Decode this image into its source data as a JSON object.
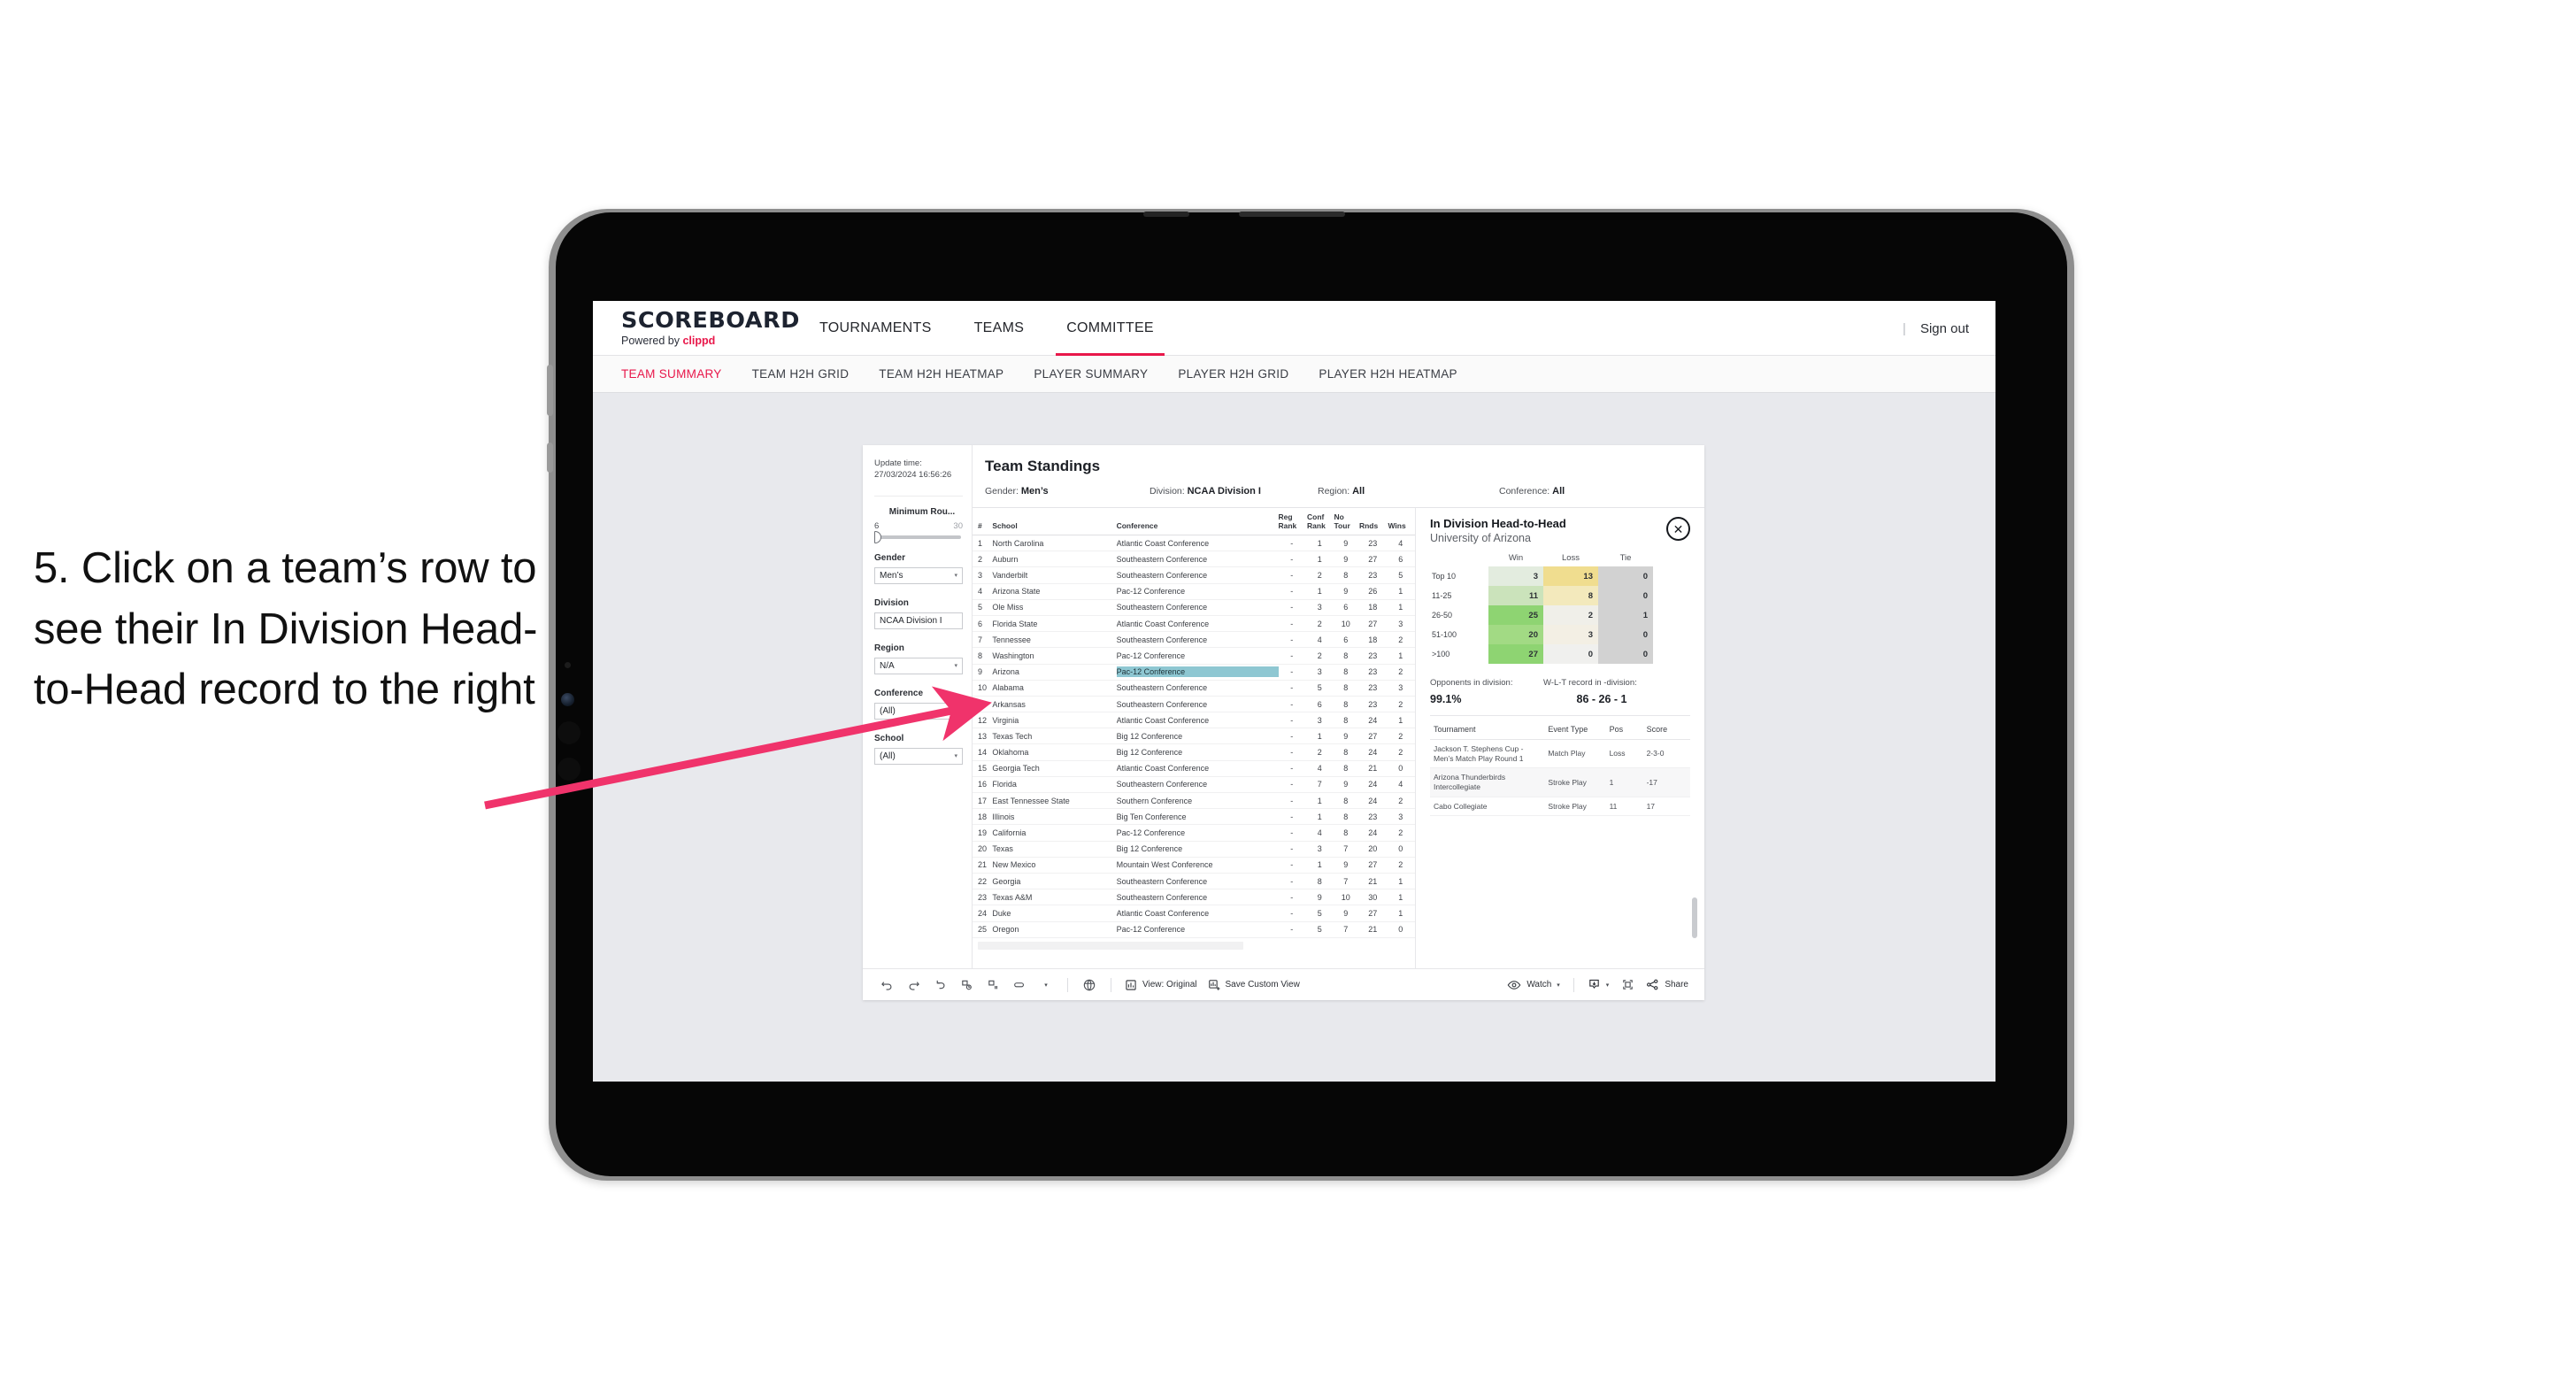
{
  "annotation": {
    "text": "5. Click on a team’s row to see their In Division Head-to-Head record to the right"
  },
  "app": {
    "brand_name": "SCOREBOARD",
    "brand_sub_prefix": "Powered by ",
    "brand_sub_clippd": "clippd",
    "sign_out": "Sign out",
    "separator": "|"
  },
  "topnav": [
    {
      "label": "TOURNAMENTS",
      "active": false
    },
    {
      "label": "TEAMS",
      "active": false
    },
    {
      "label": "COMMITTEE",
      "active": true
    }
  ],
  "subnav": [
    {
      "label": "TEAM SUMMARY",
      "active": true
    },
    {
      "label": "TEAM H2H GRID",
      "active": false
    },
    {
      "label": "TEAM H2H HEATMAP",
      "active": false
    },
    {
      "label": "PLAYER SUMMARY",
      "active": false
    },
    {
      "label": "PLAYER H2H GRID",
      "active": false
    },
    {
      "label": "PLAYER H2H HEATMAP",
      "active": false
    }
  ],
  "filters": {
    "update_time_label": "Update time:",
    "update_time_value": "27/03/2024 16:56:26",
    "min_rounds": {
      "label": "Minimum Rou...",
      "min": "6",
      "max": "30"
    },
    "gender": {
      "label": "Gender",
      "value": "Men’s"
    },
    "division": {
      "label": "Division",
      "value": "NCAA Division I"
    },
    "region": {
      "label": "Region",
      "value": "N/A"
    },
    "conference": {
      "label": "Conference",
      "value": "(All)"
    },
    "school": {
      "label": "School",
      "value": "(All)"
    },
    "caret": "▾"
  },
  "viz": {
    "title": "Team Standings",
    "summary": [
      {
        "label": "Gender: ",
        "value": "Men’s"
      },
      {
        "label": "Division: ",
        "value": "NCAA Division I"
      },
      {
        "label": "Region: ",
        "value": "All"
      },
      {
        "label": "Conference: ",
        "value": "All"
      }
    ]
  },
  "standings": {
    "columns": [
      "#",
      "School",
      "Conference",
      "Reg Rank",
      "Conf Rank",
      "No Tour",
      "Rnds",
      "Wins"
    ],
    "rows": [
      {
        "rank": "1",
        "school": "North Carolina",
        "conference": "Atlantic Coast Conference",
        "reg_rank": "-",
        "conf_rank": "1",
        "no_tour": "9",
        "rnds": "23",
        "wins": "4",
        "highlight": false
      },
      {
        "rank": "2",
        "school": "Auburn",
        "conference": "Southeastern Conference",
        "reg_rank": "-",
        "conf_rank": "1",
        "no_tour": "9",
        "rnds": "27",
        "wins": "6",
        "highlight": false
      },
      {
        "rank": "3",
        "school": "Vanderbilt",
        "conference": "Southeastern Conference",
        "reg_rank": "-",
        "conf_rank": "2",
        "no_tour": "8",
        "rnds": "23",
        "wins": "5",
        "highlight": false
      },
      {
        "rank": "4",
        "school": "Arizona State",
        "conference": "Pac-12 Conference",
        "reg_rank": "-",
        "conf_rank": "1",
        "no_tour": "9",
        "rnds": "26",
        "wins": "1",
        "highlight": false
      },
      {
        "rank": "5",
        "school": "Ole Miss",
        "conference": "Southeastern Conference",
        "reg_rank": "-",
        "conf_rank": "3",
        "no_tour": "6",
        "rnds": "18",
        "wins": "1",
        "highlight": false
      },
      {
        "rank": "6",
        "school": "Florida State",
        "conference": "Atlantic Coast Conference",
        "reg_rank": "-",
        "conf_rank": "2",
        "no_tour": "10",
        "rnds": "27",
        "wins": "3",
        "highlight": false
      },
      {
        "rank": "7",
        "school": "Tennessee",
        "conference": "Southeastern Conference",
        "reg_rank": "-",
        "conf_rank": "4",
        "no_tour": "6",
        "rnds": "18",
        "wins": "2",
        "highlight": false
      },
      {
        "rank": "8",
        "school": "Washington",
        "conference": "Pac-12 Conference",
        "reg_rank": "-",
        "conf_rank": "2",
        "no_tour": "8",
        "rnds": "23",
        "wins": "1",
        "highlight": false
      },
      {
        "rank": "9",
        "school": "Arizona",
        "conference": "Pac-12 Conference",
        "reg_rank": "-",
        "conf_rank": "3",
        "no_tour": "8",
        "rnds": "23",
        "wins": "2",
        "highlight": true
      },
      {
        "rank": "10",
        "school": "Alabama",
        "conference": "Southeastern Conference",
        "reg_rank": "-",
        "conf_rank": "5",
        "no_tour": "8",
        "rnds": "23",
        "wins": "3",
        "highlight": false
      },
      {
        "rank": "11",
        "school": "Arkansas",
        "conference": "Southeastern Conference",
        "reg_rank": "-",
        "conf_rank": "6",
        "no_tour": "8",
        "rnds": "23",
        "wins": "2",
        "highlight": false
      },
      {
        "rank": "12",
        "school": "Virginia",
        "conference": "Atlantic Coast Conference",
        "reg_rank": "-",
        "conf_rank": "3",
        "no_tour": "8",
        "rnds": "24",
        "wins": "1",
        "highlight": false
      },
      {
        "rank": "13",
        "school": "Texas Tech",
        "conference": "Big 12 Conference",
        "reg_rank": "-",
        "conf_rank": "1",
        "no_tour": "9",
        "rnds": "27",
        "wins": "2",
        "highlight": false
      },
      {
        "rank": "14",
        "school": "Oklahoma",
        "conference": "Big 12 Conference",
        "reg_rank": "-",
        "conf_rank": "2",
        "no_tour": "8",
        "rnds": "24",
        "wins": "2",
        "highlight": false
      },
      {
        "rank": "15",
        "school": "Georgia Tech",
        "conference": "Atlantic Coast Conference",
        "reg_rank": "-",
        "conf_rank": "4",
        "no_tour": "8",
        "rnds": "21",
        "wins": "0",
        "highlight": false
      },
      {
        "rank": "16",
        "school": "Florida",
        "conference": "Southeastern Conference",
        "reg_rank": "-",
        "conf_rank": "7",
        "no_tour": "9",
        "rnds": "24",
        "wins": "4",
        "highlight": false
      },
      {
        "rank": "17",
        "school": "East Tennessee State",
        "conference": "Southern Conference",
        "reg_rank": "-",
        "conf_rank": "1",
        "no_tour": "8",
        "rnds": "24",
        "wins": "2",
        "highlight": false
      },
      {
        "rank": "18",
        "school": "Illinois",
        "conference": "Big Ten Conference",
        "reg_rank": "-",
        "conf_rank": "1",
        "no_tour": "8",
        "rnds": "23",
        "wins": "3",
        "highlight": false
      },
      {
        "rank": "19",
        "school": "California",
        "conference": "Pac-12 Conference",
        "reg_rank": "-",
        "conf_rank": "4",
        "no_tour": "8",
        "rnds": "24",
        "wins": "2",
        "highlight": false
      },
      {
        "rank": "20",
        "school": "Texas",
        "conference": "Big 12 Conference",
        "reg_rank": "-",
        "conf_rank": "3",
        "no_tour": "7",
        "rnds": "20",
        "wins": "0",
        "highlight": false
      },
      {
        "rank": "21",
        "school": "New Mexico",
        "conference": "Mountain West Conference",
        "reg_rank": "-",
        "conf_rank": "1",
        "no_tour": "9",
        "rnds": "27",
        "wins": "2",
        "highlight": false
      },
      {
        "rank": "22",
        "school": "Georgia",
        "conference": "Southeastern Conference",
        "reg_rank": "-",
        "conf_rank": "8",
        "no_tour": "7",
        "rnds": "21",
        "wins": "1",
        "highlight": false
      },
      {
        "rank": "23",
        "school": "Texas A&M",
        "conference": "Southeastern Conference",
        "reg_rank": "-",
        "conf_rank": "9",
        "no_tour": "10",
        "rnds": "30",
        "wins": "1",
        "highlight": false
      },
      {
        "rank": "24",
        "school": "Duke",
        "conference": "Atlantic Coast Conference",
        "reg_rank": "-",
        "conf_rank": "5",
        "no_tour": "9",
        "rnds": "27",
        "wins": "1",
        "highlight": false
      },
      {
        "rank": "25",
        "school": "Oregon",
        "conference": "Pac-12 Conference",
        "reg_rank": "-",
        "conf_rank": "5",
        "no_tour": "7",
        "rnds": "21",
        "wins": "0",
        "highlight": false
      }
    ]
  },
  "h2h": {
    "title": "In Division Head-to-Head",
    "subtitle": "University of Arizona",
    "close_icon": "✕",
    "opponents_label": "Opponents in division:",
    "opponents_value": "99.1%",
    "record_label": "W-L-T record in -division:",
    "record_value": "86 - 26 - 1",
    "tournament_columns": [
      "Tournament",
      "Event Type",
      "Pos",
      "Score"
    ],
    "tournaments": [
      {
        "name": "Jackson T. Stephens Cup - Men’s Match Play Round 1",
        "event_type": "Match Play",
        "pos": "Loss",
        "score": "2-3-0"
      },
      {
        "name": "Arizona Thunderbirds Intercollegiate",
        "event_type": "Stroke Play",
        "pos": "1",
        "score": "-17"
      },
      {
        "name": "Cabo Collegiate",
        "event_type": "Stroke Play",
        "pos": "11",
        "score": "17"
      }
    ]
  },
  "chart_data": {
    "type": "heatmap",
    "title": "In Division Head-to-Head",
    "subtitle": "University of Arizona",
    "columns": [
      "Win",
      "Loss",
      "Tie"
    ],
    "rows": [
      "Top 10",
      "11-25",
      "26-50",
      "51-100",
      ">100"
    ],
    "values": [
      [
        3,
        13,
        0
      ],
      [
        11,
        8,
        0
      ],
      [
        25,
        2,
        1
      ],
      [
        20,
        3,
        0
      ],
      [
        27,
        0,
        0
      ]
    ],
    "cell_colors": [
      [
        "#e3ecdf",
        "#f0dd8f",
        "#d2d2d2"
      ],
      [
        "#cbe3bb",
        "#f3e9bc",
        "#d2d2d2"
      ],
      [
        "#8ed472",
        "#f0efe9",
        "#d2d2d2"
      ],
      [
        "#a2da84",
        "#f3efe4",
        "#d2d2d2"
      ],
      [
        "#8ed472",
        "#f0f0ee",
        "#d2d2d2"
      ]
    ],
    "colorscale": {
      "win_low": "#e3ecdf",
      "win_high": "#8ed472",
      "loss_high": "#f0dd8f",
      "tie": "#d2d2d2"
    },
    "legend": "none",
    "grid": false
  },
  "toolbar": {
    "view_label": "View: Original",
    "save_label": "Save Custom View",
    "watch_label": "Watch",
    "share_label": "Share",
    "caret": "▾",
    "icons": [
      "undo-icon",
      "redo-icon",
      "revert-icon",
      "refresh-data-icon",
      "pause-updates-icon",
      "highlight-icon"
    ]
  },
  "colors": {
    "accent": "#e8174a",
    "highlight_row": "#8ec7d2",
    "screen_bg": "#e8e9ed",
    "arrow": "#f0336b"
  }
}
